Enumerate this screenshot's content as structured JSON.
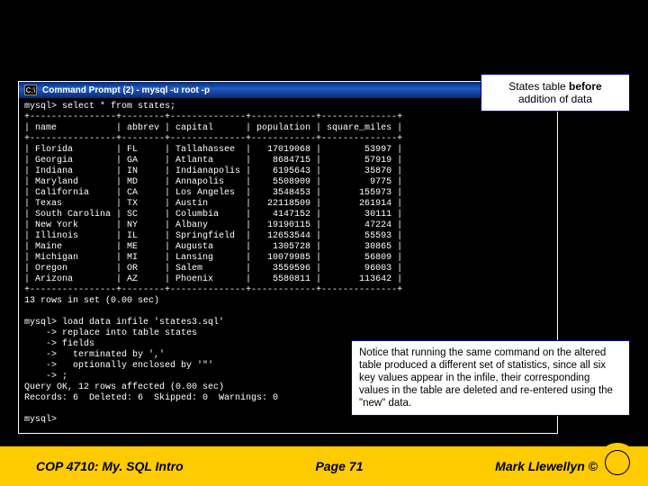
{
  "window": {
    "title": "Command Prompt (2) - mysql -u root -p"
  },
  "terminal": {
    "prompt1": "mysql> select * from states;",
    "border_top": "+----------------+--------+--------------+------------+--------------+",
    "header": "| name           | abbrev | capital      | population | square_miles |",
    "border_mid": "+----------------+--------+--------------+------------+--------------+",
    "rows": [
      "| Florida        | FL     | Tallahassee  |   17019068 |        53997 |",
      "| Georgia        | GA     | Atlanta      |    8684715 |        57919 |",
      "| Indiana        | IN     | Indianapolis |    6195643 |        35870 |",
      "| Maryland       | MD     | Annapolis    |    5508909 |         9775 |",
      "| California     | CA     | Los Angeles  |    3548453 |       155973 |",
      "| Texas          | TX     | Austin       |   22118509 |       261914 |",
      "| South Carolina | SC     | Columbia     |    4147152 |        30111 |",
      "| New York       | NY     | Albany       |   19190115 |        47224 |",
      "| Illinois       | IL     | Springfield  |   12653544 |        55593 |",
      "| Maine          | ME     | Augusta      |    1305728 |        30865 |",
      "| Michigan       | MI     | Lansing      |   10079985 |        56809 |",
      "| Oregon         | OR     | Salem        |    3559596 |        96003 |",
      "| Arizona        | AZ     | Phoenix      |    5580811 |       113642 |"
    ],
    "border_bot": "+----------------+--------+--------------+------------+--------------+",
    "rowcount": "13 rows in set (0.00 sec)",
    "load_lines": [
      "mysql> load data infile 'states3.sql'",
      "    -> replace into table states",
      "    -> fields",
      "    ->   terminated by ','",
      "    ->   optionally enclosed by '\"'",
      "    -> ;"
    ],
    "query_result": "Query OK, 12 rows affected (0.00 sec)",
    "records_line": "Records: 6  Deleted: 6  Skipped: 0  Warnings: 0",
    "final_prompt": "mysql>"
  },
  "callouts": {
    "c1_prefix": "States table ",
    "c1_bold": "before",
    "c1_suffix": " addition of data",
    "c2": "Notice that running the same command on the altered table produced a different set of statistics, since all six key values appear in the infile, their corresponding values in the table are deleted and re-entered using the \"new\" data."
  },
  "footer": {
    "course": "COP 4710: My. SQL Intro",
    "page": "Page 71",
    "author": "Mark Llewellyn ©"
  }
}
